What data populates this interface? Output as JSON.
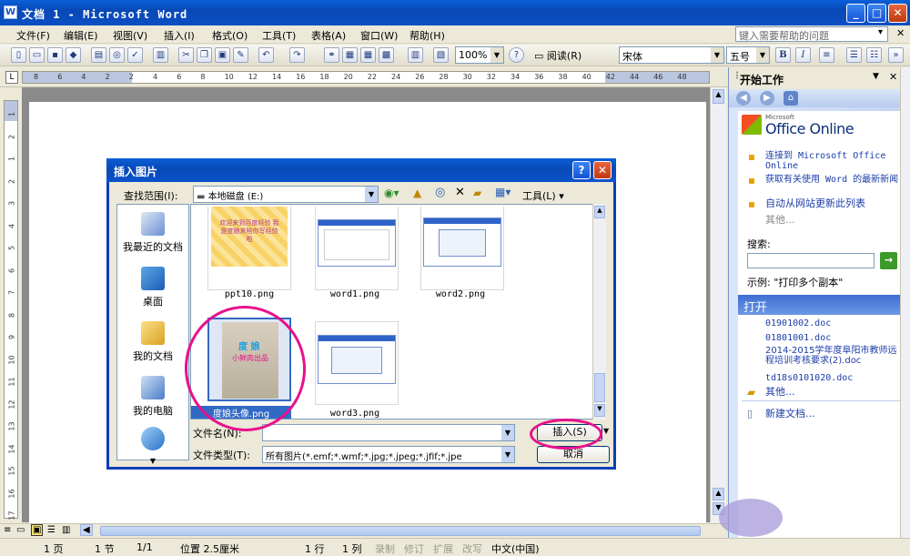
{
  "window": {
    "title": "文档 1 - Microsoft Word",
    "min": "_",
    "max": "□",
    "close": "✕"
  },
  "menu": {
    "items": [
      "文件(F)",
      "编辑(E)",
      "视图(V)",
      "插入(I)",
      "格式(O)",
      "工具(T)",
      "表格(A)",
      "窗口(W)",
      "帮助(H)"
    ],
    "help_placeholder": "键入需要帮助的问题"
  },
  "toolbar": {
    "zoom": "100%",
    "read_label": "阅读(R)",
    "font": "宋体",
    "size": "五号",
    "bold": "B",
    "italic": "I"
  },
  "ruler": {
    "ticks": [
      "8",
      "6",
      "4",
      "2",
      "2",
      "4",
      "6",
      "8",
      "10",
      "12",
      "14",
      "16",
      "18",
      "20",
      "22",
      "24",
      "26",
      "28",
      "30",
      "32",
      "34",
      "36",
      "38",
      "40",
      "42",
      "44",
      "46",
      "48"
    ]
  },
  "vruler": {
    "ticks": [
      "1",
      "2",
      "1",
      "2",
      "3",
      "4",
      "5",
      "6",
      "7",
      "8",
      "9",
      "10",
      "11",
      "12",
      "13",
      "14",
      "15",
      "16",
      "17",
      "18"
    ]
  },
  "dialog": {
    "title": "插入图片",
    "help": "?",
    "close": "✕",
    "look_in_label": "查找范围(I):",
    "look_in_value": "本地磁盘 (E:)",
    "tools_label": "工具(L)",
    "places": [
      "我最近的文档",
      "桌面",
      "我的文档",
      "我的电脑",
      "网上邻居"
    ],
    "files": [
      "ppt10.png",
      "word1.png",
      "word2.png",
      "度娘头像.png",
      "word3.png"
    ],
    "thumb_text": {
      "ppt_lines": "欢迎来到百度经验 我是度娘来陪你写经验啦",
      "avatar_name": "度 娘",
      "avatar_sub": "小鲜肉出品"
    },
    "filename_label": "文件名(N):",
    "filename_value": "",
    "filetype_label": "文件类型(T):",
    "filetype_value": "所有图片(*.emf;*.wmf;*.jpg;*.jpeg;*.jfif;*.jpe",
    "insert_button": "插入(S)",
    "cancel_button": "取消"
  },
  "taskpane": {
    "title": "开始工作",
    "office_online": "Office Online",
    "office_micro": "Microsoft",
    "links": [
      "连接到 Microsoft Office Online",
      "获取有关使用 Word 的最新新闻",
      "自动从网站更新此列表"
    ],
    "more": "其他...",
    "search_label": "搜索:",
    "example": "示例: \"打印多个副本\"",
    "open_title": "打开",
    "recent_files": [
      "01901002.doc",
      "01801001.doc",
      "2014-2015学年度阜阳市教师远程培训考核要求(2).doc",
      "td18s0101020.doc"
    ],
    "open_more": "其他...",
    "new_doc": "新建文档..."
  },
  "status": {
    "page": "1 页",
    "section": "1 节",
    "pages": "1/1",
    "pos": "位置 2.5厘米",
    "line": "1 行",
    "col": "1 列",
    "rec": "录制",
    "trk": "修订",
    "ext": "扩展",
    "ovr": "改写",
    "lang": "中文(中国)"
  },
  "colors": {
    "xp_blue": "#0a5fd8",
    "highlight_ring": "#e8118c",
    "link": "#1b3ca8"
  }
}
